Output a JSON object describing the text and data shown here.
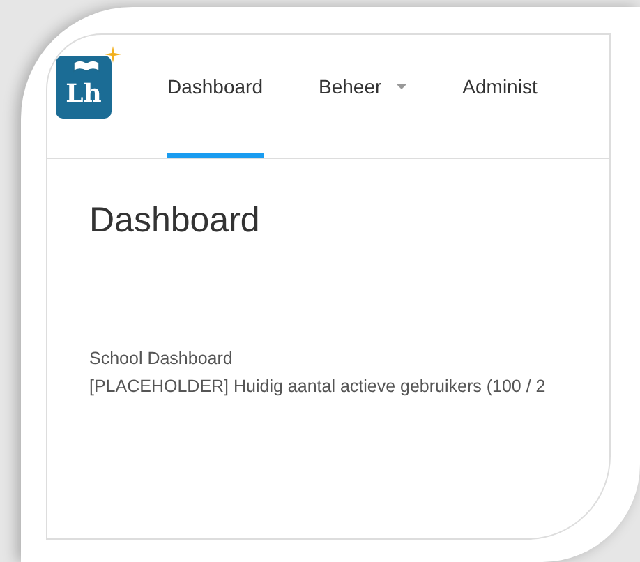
{
  "logo": {
    "text": "Lh"
  },
  "tabs": [
    {
      "label": "Dashboard",
      "selected": true,
      "dropdown": false
    },
    {
      "label": "Beheer",
      "selected": false,
      "dropdown": true
    },
    {
      "label": "Administ",
      "selected": false,
      "dropdown": false
    }
  ],
  "page_title": "Dashboard",
  "lines": [
    "School Dashboard",
    "[PLACEHOLDER] Huidig aantal actieve gebruikers (100 / 2"
  ]
}
